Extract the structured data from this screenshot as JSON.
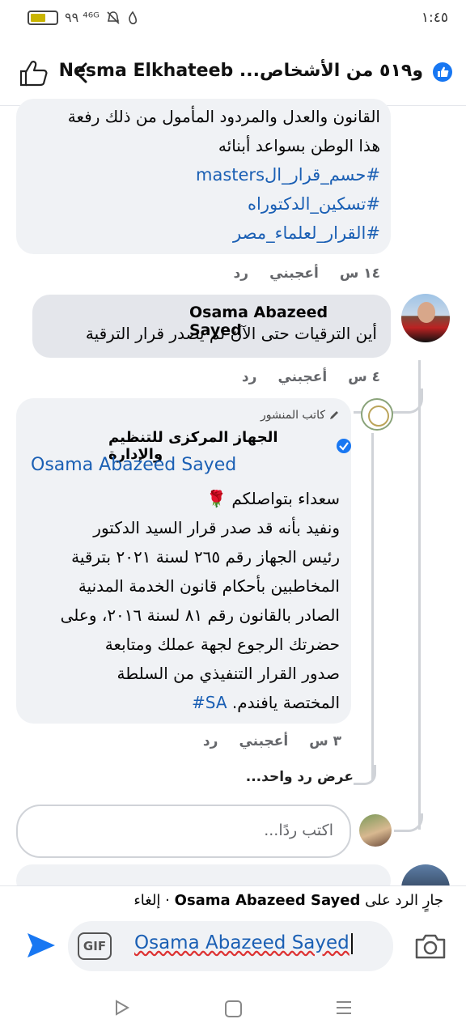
{
  "status": {
    "time": "١:٤٥",
    "left_icons": "۹٩ ⁴⁶ᴳ"
  },
  "header": {
    "title": "و٥١٩ من الأشخاص... Nesma Elkhateeb"
  },
  "comment1": {
    "lines": [
      "القانون والعدل والمردود المأمول من ذلك رفعة",
      "هذا الوطن بسواعد أبنائه"
    ],
    "hashtags": [
      "#حسم_قرار_الmasters",
      "#تسكين_الدكتوراه",
      "#القرار_لعلماء_مصر"
    ],
    "time": "١٤ س",
    "like": "أعجبني",
    "reply": "رد"
  },
  "comment2": {
    "name": "Osama Abazeed Sayed",
    "text": "أين الترقيات حتى الآن لم يصدر قرار الترقية",
    "time": "٤ س",
    "like": "أعجبني",
    "reply": "رد"
  },
  "comment3": {
    "author_badge": "كاتب المنشور",
    "page_name": "الجهاز المركزى للتنظيم والإدارة",
    "mention": "Osama Abazeed Sayed",
    "lines": [
      "سعداء بتواصلكم 🌹",
      "ونفيد بأنه قد صدر قرار السيد الدكتور",
      "رئيس الجهاز رقم ٢٦٥ لسنة ٢٠٢١ بترقية",
      "المخاطبين بأحكام قانون الخدمة المدنية",
      "الصادر بالقانون رقم ٨١ لسنة ٢٠١٦، وعلى",
      "حضرتك الرجوع لجهة عملك ومتابعة",
      "صدور القرار التنفيذي من السلطة"
    ],
    "last_line": "المختصة يافندم.",
    "last_tag": "#SA",
    "time": "٣ س",
    "like": "أعجبني",
    "reply": "رد"
  },
  "view_reply": "عرض رد واحد...",
  "reply_placeholder": "اكتب ردًا...",
  "replying_bar": {
    "prefix": "جارٍ الرد على",
    "name": "Osama Abazeed Sayed",
    "sep": "·",
    "cancel": "إلغاء"
  },
  "composer": {
    "gif": "GIF",
    "value": "Osama Abazeed Sayed"
  },
  "colors": {
    "link": "#1a5fb4",
    "send": "#1877f2",
    "bubble": "#f0f2f5"
  }
}
